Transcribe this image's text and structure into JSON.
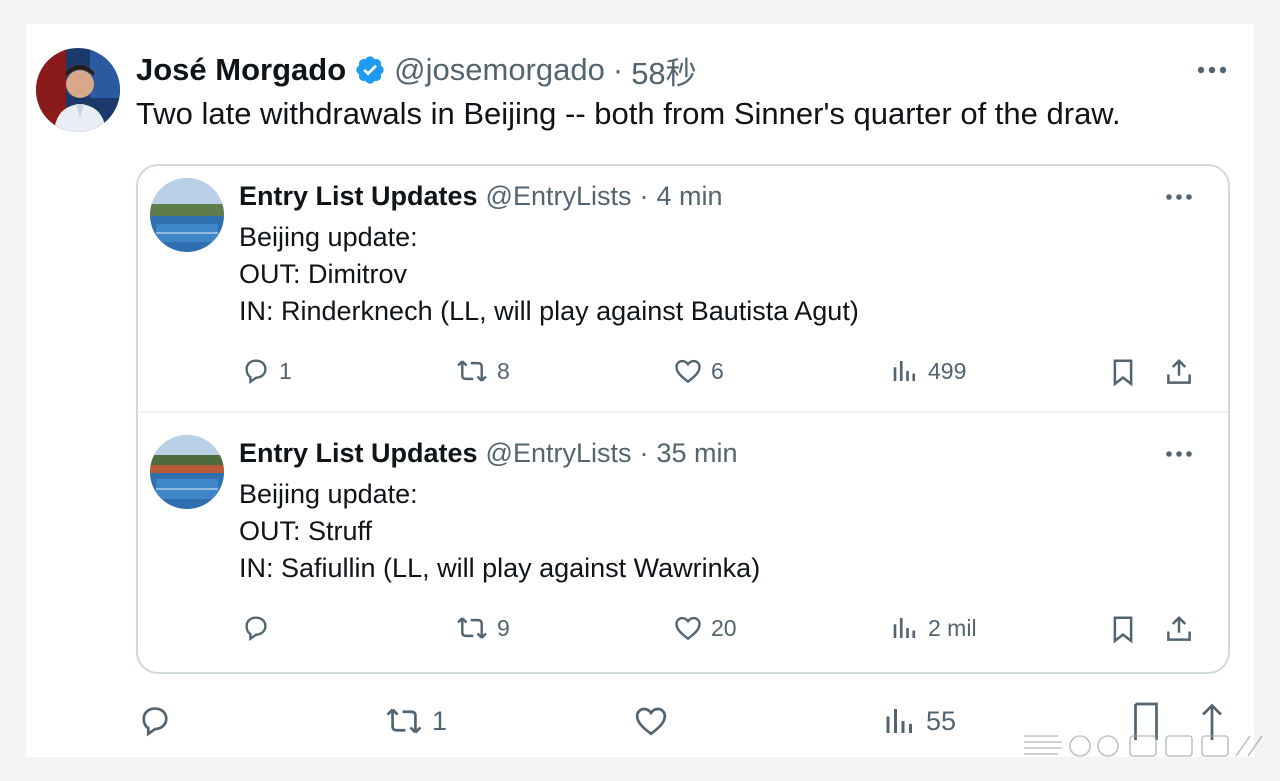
{
  "main_tweet": {
    "name": "José Morgado",
    "handle": "@josemorgado",
    "time": "58秒",
    "text": "Two late withdrawals in Beijing -- both from Sinner's quarter of the draw.",
    "verified_color": "#1d9bf0",
    "actions": {
      "reply": "",
      "retweet": "1",
      "like": "",
      "views": "55"
    }
  },
  "quotes": [
    {
      "name": "Entry List Updates",
      "handle": "@EntryLists",
      "time": "4 min",
      "lines": [
        "Beijing update:",
        "OUT: Dimitrov",
        "IN: Rinderknech (LL, will play against Bautista Agut)"
      ],
      "actions": {
        "reply": "1",
        "retweet": "8",
        "like": "6",
        "views": "499"
      }
    },
    {
      "name": "Entry List Updates",
      "handle": "@EntryLists",
      "time": "35 min",
      "lines": [
        "Beijing update:",
        "OUT: Struff",
        "IN: Safiullin (LL, will play against Wawrinka)"
      ],
      "actions": {
        "reply": "",
        "retweet": "9",
        "like": "20",
        "views": "2 mil"
      }
    }
  ],
  "icons": [
    "verified-badge-icon",
    "more-icon",
    "reply-icon",
    "retweet-icon",
    "like-icon",
    "views-icon",
    "bookmark-icon",
    "share-icon"
  ],
  "colors": {
    "text": "#0f1419",
    "secondary": "#536471",
    "border": "#cfd9de",
    "accent": "#1d9bf0"
  }
}
